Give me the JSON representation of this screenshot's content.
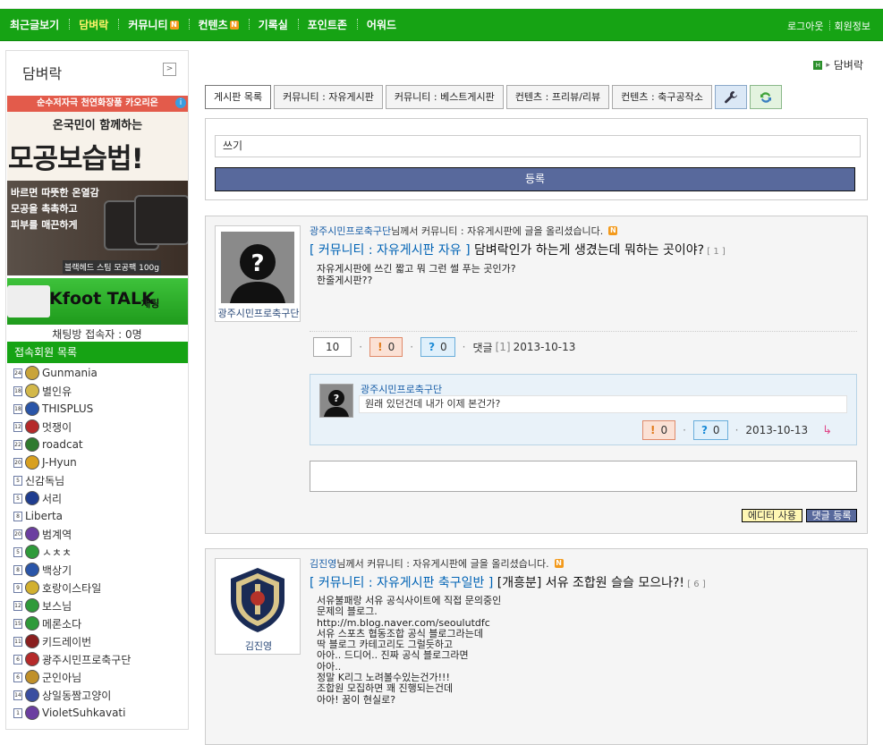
{
  "nav": {
    "items": [
      {
        "label": "최근글보기",
        "badge": ""
      },
      {
        "label": "담벼락",
        "badge": ""
      },
      {
        "label": "커뮤니티",
        "badge": "N"
      },
      {
        "label": "컨텐츠",
        "badge": "N"
      },
      {
        "label": "기록실",
        "badge": ""
      },
      {
        "label": "포인트존",
        "badge": ""
      },
      {
        "label": "어워드",
        "badge": ""
      }
    ],
    "active": "담벼락",
    "logout": "로그아웃",
    "member_info": "회원정보"
  },
  "sidebar": {
    "title": "담벼락",
    "toggle": ">",
    "ad1": {
      "top": "순수저자극 천연화장품 카오리온",
      "sub": "온국민이 함께하는",
      "big": "모공보습법!",
      "lines": [
        "바르면 따뜻한 온열감",
        "모공을 촉촉하고",
        "피부를 매끈하게"
      ],
      "bottom": "블랙헤드 스팀 모공팩 100g",
      "info": "i"
    },
    "ad2": {
      "title": "Kfoot TALK",
      "chat": "채팅"
    },
    "chat_count": "채팅방 접속자 : 0명",
    "online_header": "접속회원 목록",
    "members": [
      {
        "name": "Gunmania",
        "lvl": "24",
        "color": "#c9a43a"
      },
      {
        "name": "별인유",
        "lvl": "18",
        "color": "#d3b84a"
      },
      {
        "name": "THISPLUS",
        "lvl": "18",
        "color": "#2a55a8"
      },
      {
        "name": "멋쟁이",
        "lvl": "12",
        "color": "#b52a2a"
      },
      {
        "name": "roadcat",
        "lvl": "22",
        "color": "#2f7a2f"
      },
      {
        "name": "J-Hyun",
        "lvl": "20",
        "color": "#d8a020"
      },
      {
        "name": "신감독님",
        "lvl": "5",
        "color": ""
      },
      {
        "name": "서리",
        "lvl": "5",
        "color": "#1f3d8f"
      },
      {
        "name": "Liberta",
        "lvl": "8",
        "color": ""
      },
      {
        "name": "범계역",
        "lvl": "20",
        "color": "#6b3ea0"
      },
      {
        "name": "ㅅㅊㅊ",
        "lvl": "5",
        "color": "#2f9a3a"
      },
      {
        "name": "백상기",
        "lvl": "8",
        "color": "#2a55a8"
      },
      {
        "name": "호랑이스타일",
        "lvl": "9",
        "color": "#d2b030"
      },
      {
        "name": "보스님",
        "lvl": "12",
        "color": "#2f9a3a"
      },
      {
        "name": "메론소다",
        "lvl": "15",
        "color": "#2f9a3a"
      },
      {
        "name": "키드레이번",
        "lvl": "11",
        "color": "#8a1f1f"
      },
      {
        "name": "광주시민프로축구단",
        "lvl": "6",
        "color": "#b52a2a"
      },
      {
        "name": "군인아님",
        "lvl": "6",
        "color": "#c0902a"
      },
      {
        "name": "상일동짬고양이",
        "lvl": "14",
        "color": "#3a4ea0"
      },
      {
        "name": "VioletSuhkavati",
        "lvl": "1",
        "color": "#6b3ea0"
      }
    ]
  },
  "breadcrumb": {
    "home": "H",
    "sep": "▸",
    "current": "담벼락"
  },
  "tabs": [
    "게시판 목록",
    "커뮤니티 : 자유게시판",
    "커뮤니티 : 베스트게시판",
    "컨텐츠 : 프리뷰/리뷰",
    "컨텐츠 : 축구공작소"
  ],
  "write": {
    "value": "쓰기",
    "submit": "등록"
  },
  "posts": [
    {
      "author_meta": "광주시민프로축구단",
      "meta_rest": " 님께서 커뮤니티 : 자유게시판에 글을 올리셨습니다.",
      "new_badge": "N",
      "board": "[ 커뮤니티 : 자유게시판",
      "category": " 자유 ]",
      "title": " 담벼락인가 하는게 생겼는데 뭐하는 곳이야?",
      "comment_count": " [ 1 ]",
      "body": "자유게시판에 쓰긴 짧고 뭐 그런 썰 푸는 곳인가?\n한줄게시판??",
      "avatar_name": "광주시민프로축구단",
      "views": "10",
      "bad": "0",
      "q": "0",
      "comments_label": "댓글",
      "comments_num": "[1]",
      "date": "2013-10-13",
      "comment": {
        "name": "광주시민프로축구단",
        "text": "원래 있던건데 내가 이제 본건가?",
        "bad": "0",
        "q": "0",
        "date": "2013-10-13"
      },
      "btn_editor": "에디터 사용",
      "btn_comment": "댓글 등록"
    },
    {
      "author_meta": "김진영",
      "meta_rest": " 님께서 커뮤니티 : 자유게시판에 글을 올리셨습니다.",
      "new_badge": "N",
      "board": "[ 커뮤니티 : 자유게시판",
      "category": " 축구일반 ]",
      "title": " [개흥분] 서유 조합원 슬슬 모으나?!",
      "comment_count": " [ 6 ]",
      "body": "서유불패랑 서유 공식사이트에 직접 문의중인\n문제의 블로그.\nhttp://m.blog.naver.com/seoulutdfc\n서유 스포츠 협동조합 공식 블로그라는데\n딱 블로그 카테고리도 그럴듯하고\n아아.. 드디어.. 진짜 공식 블로그라면\n아아..\n정말 K리그 노려볼수있는건가!!!\n조합원 모집하면 꽤 진행되는건데\n아아! 꿈이 현실로?",
      "avatar_name": "김진영"
    }
  ]
}
